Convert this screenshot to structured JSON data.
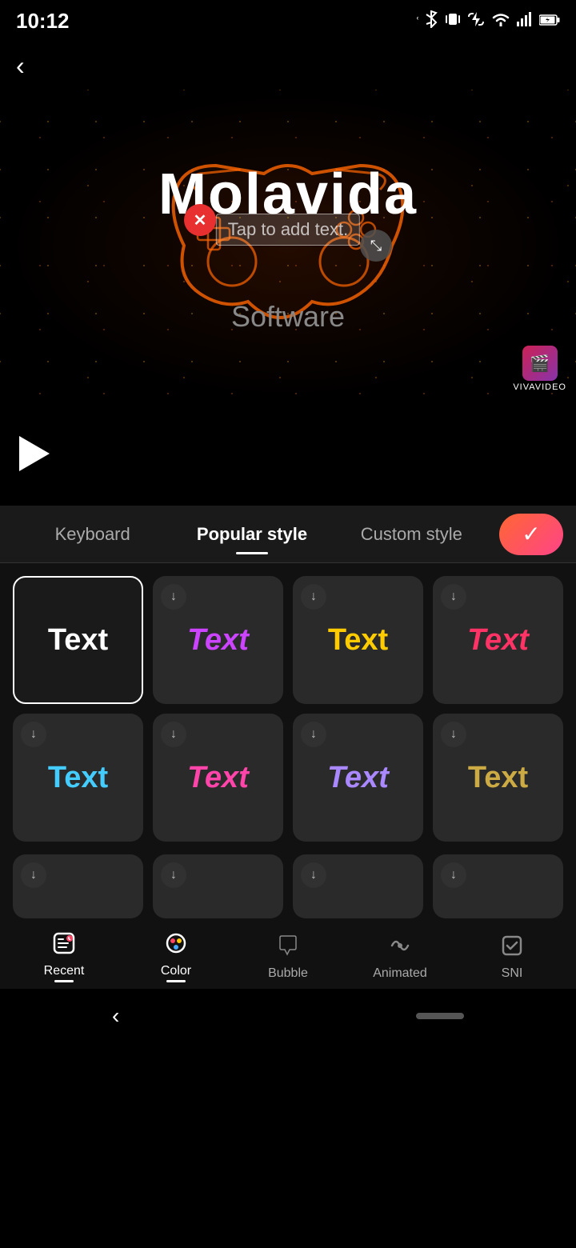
{
  "statusBar": {
    "time": "10:12",
    "icons": [
      "bluetooth",
      "vibrate",
      "charging-signal",
      "wifi",
      "signal",
      "battery"
    ]
  },
  "topBar": {
    "backLabel": "‹"
  },
  "videoPreview": {
    "title": "Molavida",
    "subtitle": "Software",
    "textInputPlaceholder": "Tap to add text.",
    "deleteLabel": "✕",
    "resizeLabel": "⤡",
    "brandName": "VIVAVIDEO"
  },
  "timelineArea": {},
  "tabsBar": {
    "tabs": [
      {
        "id": "keyboard",
        "label": "Keyboard",
        "active": false
      },
      {
        "id": "popular",
        "label": "Popular style",
        "active": true
      },
      {
        "id": "custom",
        "label": "Custom style",
        "active": false
      }
    ],
    "confirmLabel": "✓"
  },
  "styleGrid": {
    "row1": [
      {
        "id": "plain-white",
        "label": "Text",
        "style": "white",
        "selected": true,
        "hasDownload": false
      },
      {
        "id": "purple-italic",
        "label": "Text",
        "style": "purple",
        "selected": false,
        "hasDownload": true
      },
      {
        "id": "yellow-bold",
        "label": "Text",
        "style": "yellow",
        "selected": false,
        "hasDownload": true
      },
      {
        "id": "pink-italic",
        "label": "Text",
        "style": "pink",
        "selected": false,
        "hasDownload": true
      }
    ],
    "row2": [
      {
        "id": "cyan-bold",
        "label": "Text",
        "style": "cyan",
        "selected": false,
        "hasDownload": true
      },
      {
        "id": "hotpink",
        "label": "Text",
        "style": "hotpink",
        "selected": false,
        "hasDownload": true
      },
      {
        "id": "lavender",
        "label": "Text",
        "style": "lavender",
        "selected": false,
        "hasDownload": true
      },
      {
        "id": "gold",
        "label": "Text",
        "style": "gold",
        "selected": false,
        "hasDownload": true
      }
    ],
    "row3": [
      {
        "id": "partial1",
        "hasDownload": true
      },
      {
        "id": "partial2",
        "hasDownload": true
      },
      {
        "id": "partial3",
        "hasDownload": true
      },
      {
        "id": "partial4",
        "hasDownload": true
      }
    ]
  },
  "bottomNav": {
    "items": [
      {
        "id": "recent-icon",
        "icon": "🎨",
        "label": "Recent",
        "active": false
      },
      {
        "id": "color-nav",
        "icon": "",
        "label": "Color",
        "active": true
      },
      {
        "id": "bubble-nav",
        "icon": "",
        "label": "Bubble",
        "active": false
      },
      {
        "id": "animated-nav",
        "icon": "",
        "label": "Animated",
        "active": false
      },
      {
        "id": "sni-nav",
        "icon": "",
        "label": "SNI",
        "active": false
      }
    ]
  },
  "systemNav": {
    "backLabel": "‹"
  }
}
